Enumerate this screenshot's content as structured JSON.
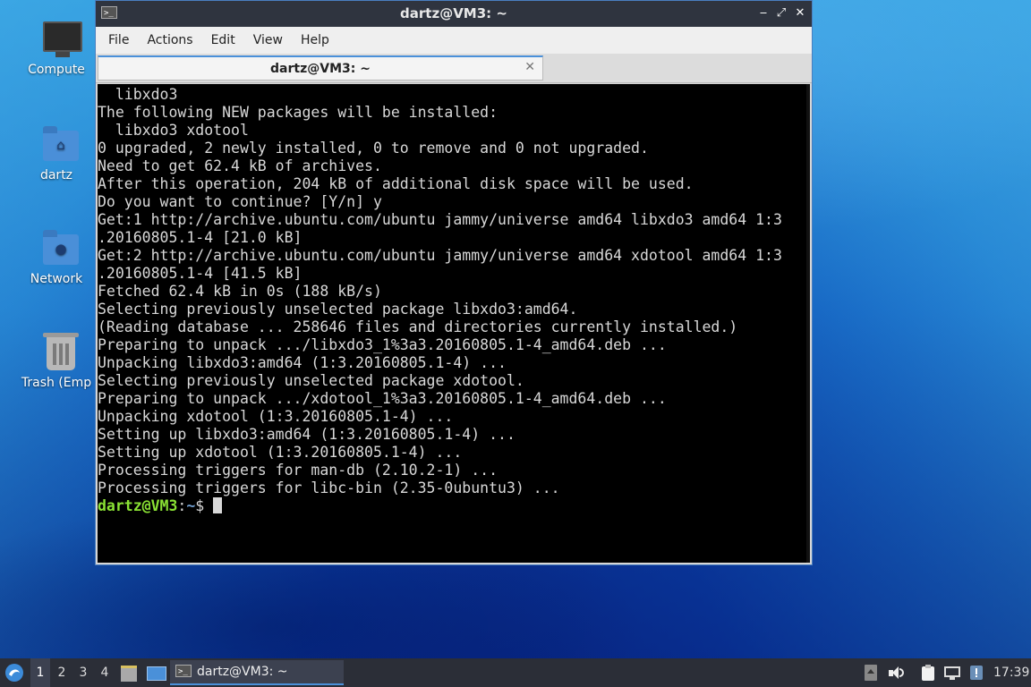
{
  "desktop": {
    "icons": [
      {
        "label": "Compute"
      },
      {
        "label": "dartz"
      },
      {
        "label": "Network"
      },
      {
        "label": "Trash (Emp"
      }
    ]
  },
  "window": {
    "title": "dartz@VM3: ~",
    "app_icon": ">_",
    "controls": {
      "minimize": "‒",
      "maximize": "⤢",
      "close": "✕"
    },
    "menu": [
      "File",
      "Actions",
      "Edit",
      "View",
      "Help"
    ],
    "tab": {
      "label": "dartz@VM3: ~",
      "close": "✕"
    }
  },
  "terminal": {
    "lines": [
      "  libxdo3",
      "The following NEW packages will be installed:",
      "  libxdo3 xdotool",
      "0 upgraded, 2 newly installed, 0 to remove and 0 not upgraded.",
      "Need to get 62.4 kB of archives.",
      "After this operation, 204 kB of additional disk space will be used.",
      "Do you want to continue? [Y/n] y",
      "Get:1 http://archive.ubuntu.com/ubuntu jammy/universe amd64 libxdo3 amd64 1:3",
      ".20160805.1-4 [21.0 kB]",
      "Get:2 http://archive.ubuntu.com/ubuntu jammy/universe amd64 xdotool amd64 1:3",
      ".20160805.1-4 [41.5 kB]",
      "Fetched 62.4 kB in 0s (188 kB/s)",
      "Selecting previously unselected package libxdo3:amd64.",
      "(Reading database ... 258646 files and directories currently installed.)",
      "Preparing to unpack .../libxdo3_1%3a3.20160805.1-4_amd64.deb ...",
      "Unpacking libxdo3:amd64 (1:3.20160805.1-4) ...",
      "Selecting previously unselected package xdotool.",
      "Preparing to unpack .../xdotool_1%3a3.20160805.1-4_amd64.deb ...",
      "Unpacking xdotool (1:3.20160805.1-4) ...",
      "Setting up libxdo3:amd64 (1:3.20160805.1-4) ...",
      "Setting up xdotool (1:3.20160805.1-4) ...",
      "Processing triggers for man-db (2.10.2-1) ...",
      "Processing triggers for libc-bin (2.35-0ubuntu3) ..."
    ],
    "prompt": {
      "user_host": "dartz@VM3",
      "sep": ":",
      "path": "~",
      "symbol": "$ "
    }
  },
  "taskbar": {
    "workspaces": [
      "1",
      "2",
      "3",
      "4"
    ],
    "active_workspace": "1",
    "task": {
      "label": "dartz@VM3: ~",
      "icon": ">_"
    },
    "clock": "17:39",
    "colors": {
      "accent": "#4a90d9",
      "panel": "#2b2e37"
    }
  }
}
